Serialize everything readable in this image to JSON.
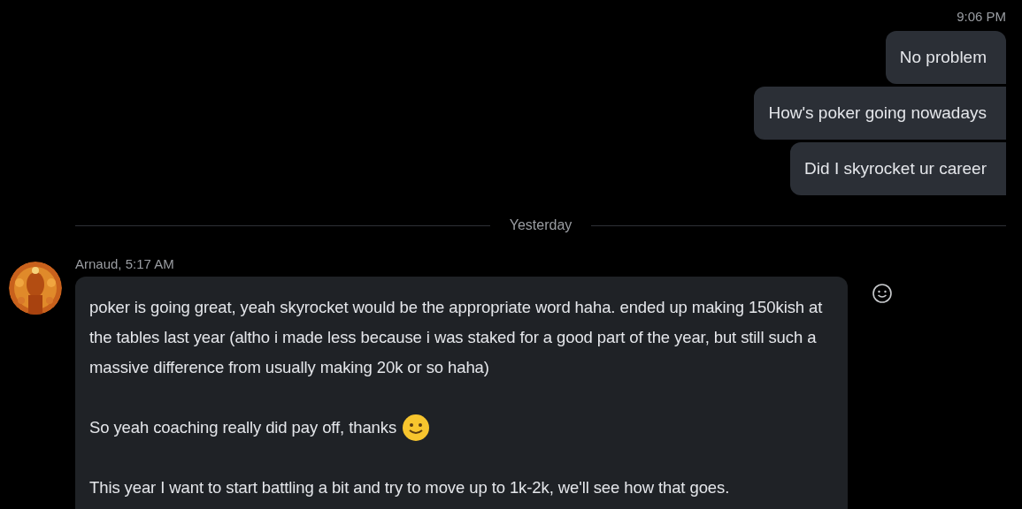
{
  "sent_group": {
    "time": "9:06 PM",
    "messages": [
      {
        "text": "No problem"
      },
      {
        "text": "How's poker going nowadays"
      },
      {
        "text": "Did I skyrocket ur career"
      }
    ]
  },
  "divider": {
    "label": "Yesterday"
  },
  "received_group": {
    "header": "Arnaud, 5:17 AM",
    "paragraphs": [
      {
        "text": "poker is going great, yeah skyrocket would be the appropriate word haha. ended up making 150kish at the tables last year (altho i made less because i was staked for a good part of the year, but still such a massive difference from usually making 20k or so haha)",
        "emoji": false
      },
      {
        "text": "So yeah coaching really did pay off, thanks",
        "emoji": true
      },
      {
        "text": "This year I want to start battling a bit and try to move up to 1k-2k, we'll see how that goes.",
        "emoji": false
      }
    ]
  }
}
